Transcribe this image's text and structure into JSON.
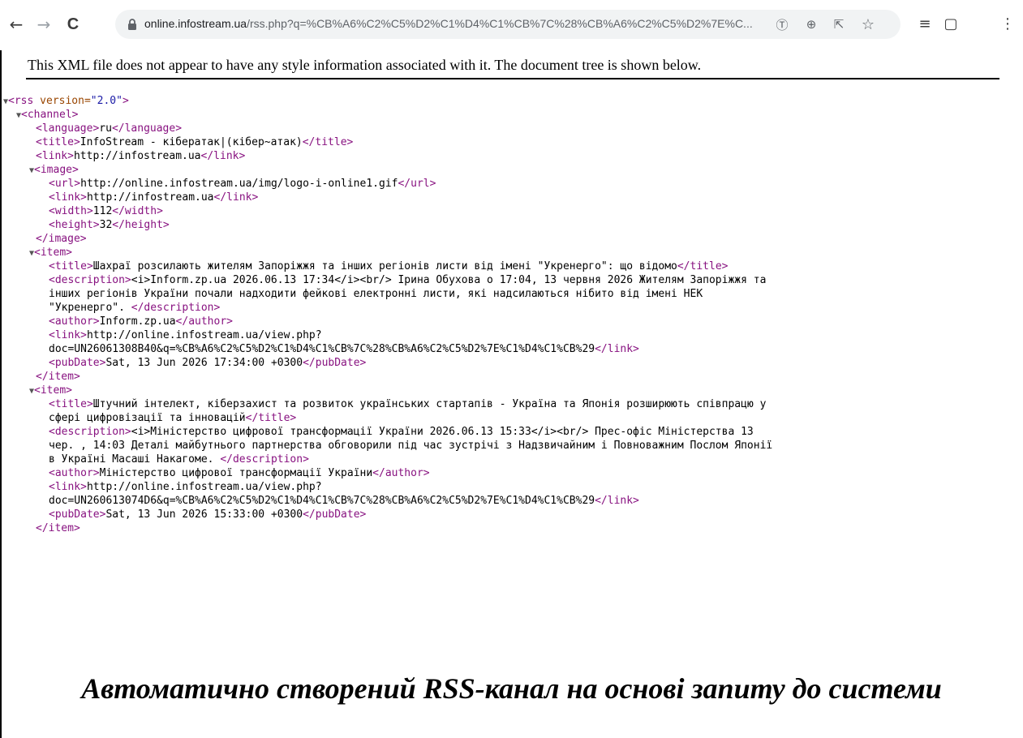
{
  "browser": {
    "url_host": "online.infostream.ua",
    "url_path": "/rss.php?q=%CB%A6%C2%C5%D2%C1%D4%C1%CB%7C%28%CB%A6%C2%C5%D2%7E%C...",
    "back_icon": "←",
    "forward_icon": "→",
    "reload_icon": "C",
    "translate_icon": "Ⓣ",
    "zoom_icon": "⊕",
    "share_icon": "⇱",
    "bookmark_icon": "☆",
    "reading_list_icon": "≡",
    "side_panel_icon": "▢",
    "menu_icon": "⋮"
  },
  "notice": "This XML file does not appear to have any style information associated with it. The document tree is shown below.",
  "xml": {
    "fold_open": "▼",
    "rss_open_tag": "<rss",
    "rss_attr_name": " version=",
    "rss_attr_value": "\"2.0\"",
    "rss_open_close": ">",
    "rss_close": "</rss>",
    "channel_open": "<channel>",
    "language_open": "<language>",
    "language_value": "ru",
    "language_close": "</language>",
    "title_open": "<title>",
    "title_close": "</title>",
    "channel_title": "InfoStream - кібератак|(кібер~атак)",
    "link_open": "<link>",
    "link_close": "</link>",
    "channel_link": "http://infostream.ua",
    "image_open": "<image>",
    "image_close": "</image>",
    "url_open": "<url>",
    "url_close": "</url>",
    "image_url": "http://online.infostream.ua/img/logo-i-online1.gif",
    "image_link": "http://infostream.ua",
    "width_open": "<width>",
    "width_close": "</width>",
    "image_width": "112",
    "height_open": "<height>",
    "height_close": "</height>",
    "image_height": "32",
    "item_open": "<item>",
    "item_close": "</item>",
    "description_open": "<description>",
    "description_close": "</description>",
    "author_open": "<author>",
    "author_close": "</author>",
    "pubdate_open": "<pubDate>",
    "pubdate_close": "</pubDate>",
    "items": [
      {
        "title": "Шахраї розсилають жителям Запоріжжя та інших регіонів листи від імені \"Укренерго\": що відомо",
        "description_line1": "<i>Inform.zp.ua 2026.06.13 17:34</i><br/> Ірина Обухова о 17:04, 13 червня 2026 Жителям Запоріжжя та",
        "description_line2": "інших регіонів України почали надходити фейкові електронні листи, які надсилаються нібито від імені НЕК",
        "description_line3": "\"Укренерго\". ",
        "author": "Inform.zp.ua",
        "link_line1": "http://online.infostream.ua/view.php?",
        "link_line2": "doc=UN26061308B40&q=%CB%A6%C2%C5%D2%C1%D4%C1%CB%7C%28%CB%A6%C2%C5%D2%7E%C1%D4%C1%CB%29",
        "pubdate": "Sat, 13 Jun 2026 17:34:00 +0300"
      },
      {
        "title_line1": "Штучний інтелект, кіберзахист та розвиток українських стартапів - Україна та Японія розширюють співпрацю у",
        "title_line2": "сфері цифровізації та інновацій",
        "description_line1": "<i>Міністерство цифрової трансформації України 2026.06.13 15:33</i><br/> Прес-офіс Міністерства 13",
        "description_line2": "чер. , 14:03 Деталі майбутнього партнерства обговорили під час зустрічі з Надзвичайним і Повноважним Послом Японії",
        "description_line3": "в Україні Масаші Накагоме. ",
        "author": "Міністерство цифрової трансформації України",
        "link_line1": "http://online.infostream.ua/view.php?",
        "link_line2": "doc=UN260613074D6&q=%CB%A6%C2%C5%D2%C1%D4%C1%CB%7C%28%CB%A6%C2%C5%D2%7E%C1%D4%C1%CB%29",
        "pubdate": "Sat, 13 Jun 2026 15:33:00 +0300"
      }
    ]
  },
  "caption": "Автоматично створений RSS-канал на основі запиту до системи"
}
